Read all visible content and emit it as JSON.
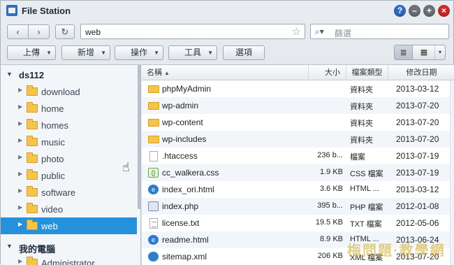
{
  "window": {
    "title": "File Station",
    "controls": {
      "help": "?",
      "minimize": "–",
      "maximize": "+",
      "close": "×"
    }
  },
  "nav": {
    "back": "‹",
    "forward": "›",
    "refresh": "↻",
    "path": "web",
    "search_placeholder": "篩選",
    "search_icon": "⌕▾"
  },
  "toolbar": {
    "upload": "上傳",
    "create": "新增",
    "action": "操作",
    "tools": "工具",
    "settings": "選項"
  },
  "view": {
    "list_icon": "≣",
    "thumb_icon": "▦",
    "caret": "▾"
  },
  "sidebar": {
    "root_label": "ds112",
    "items": [
      {
        "label": "download"
      },
      {
        "label": "home"
      },
      {
        "label": "homes"
      },
      {
        "label": "music"
      },
      {
        "label": "photo"
      },
      {
        "label": "public"
      },
      {
        "label": "software"
      },
      {
        "label": "video"
      },
      {
        "label": "web",
        "selected": true
      }
    ],
    "computer_label": "我的電腦",
    "computer_items": [
      {
        "label": "Administrator"
      }
    ]
  },
  "table": {
    "columns": {
      "name": "名稱",
      "size": "大小",
      "type": "檔案類型",
      "date": "修改日期"
    },
    "rows": [
      {
        "icon": "folder-icon",
        "name": "phpMyAdmin",
        "size": "",
        "type": "資料夾",
        "date": "2013-03-12"
      },
      {
        "icon": "folder-icon",
        "name": "wp-admin",
        "size": "",
        "type": "資料夾",
        "date": "2013-07-20"
      },
      {
        "icon": "folder-icon",
        "name": "wp-content",
        "size": "",
        "type": "資料夾",
        "date": "2013-07-20"
      },
      {
        "icon": "folder-icon",
        "name": "wp-includes",
        "size": "",
        "type": "資料夾",
        "date": "2013-07-20"
      },
      {
        "icon": "file-icon",
        "name": ".htaccess",
        "size": "236 b...",
        "type": "檔案",
        "date": "2013-07-19"
      },
      {
        "icon": "css-file-icon",
        "name": "cc_walkera.css",
        "size": "1.9 KB",
        "type": "CSS 檔案",
        "date": "2013-07-19"
      },
      {
        "icon": "html-file-icon",
        "name": "index_ori.html",
        "size": "3.6 KB",
        "type": "HTML ...",
        "date": "2013-03-12"
      },
      {
        "icon": "php-file-icon",
        "name": "index.php",
        "size": "395 b...",
        "type": "PHP 檔案",
        "date": "2012-01-08"
      },
      {
        "icon": "txt-file-icon",
        "name": "license.txt",
        "size": "19.5 KB",
        "type": "TXT 檔案",
        "date": "2012-05-06"
      },
      {
        "icon": "html-file-icon",
        "name": "readme.html",
        "size": "8.9 KB",
        "type": "HTML ...",
        "date": "2013-06-24"
      },
      {
        "icon": "xml-file-icon",
        "name": "sitemap.xml",
        "size": "206 KB",
        "type": "XML 檔案",
        "date": "2013-07-20"
      }
    ]
  },
  "watermark": "梅問題·教學網"
}
